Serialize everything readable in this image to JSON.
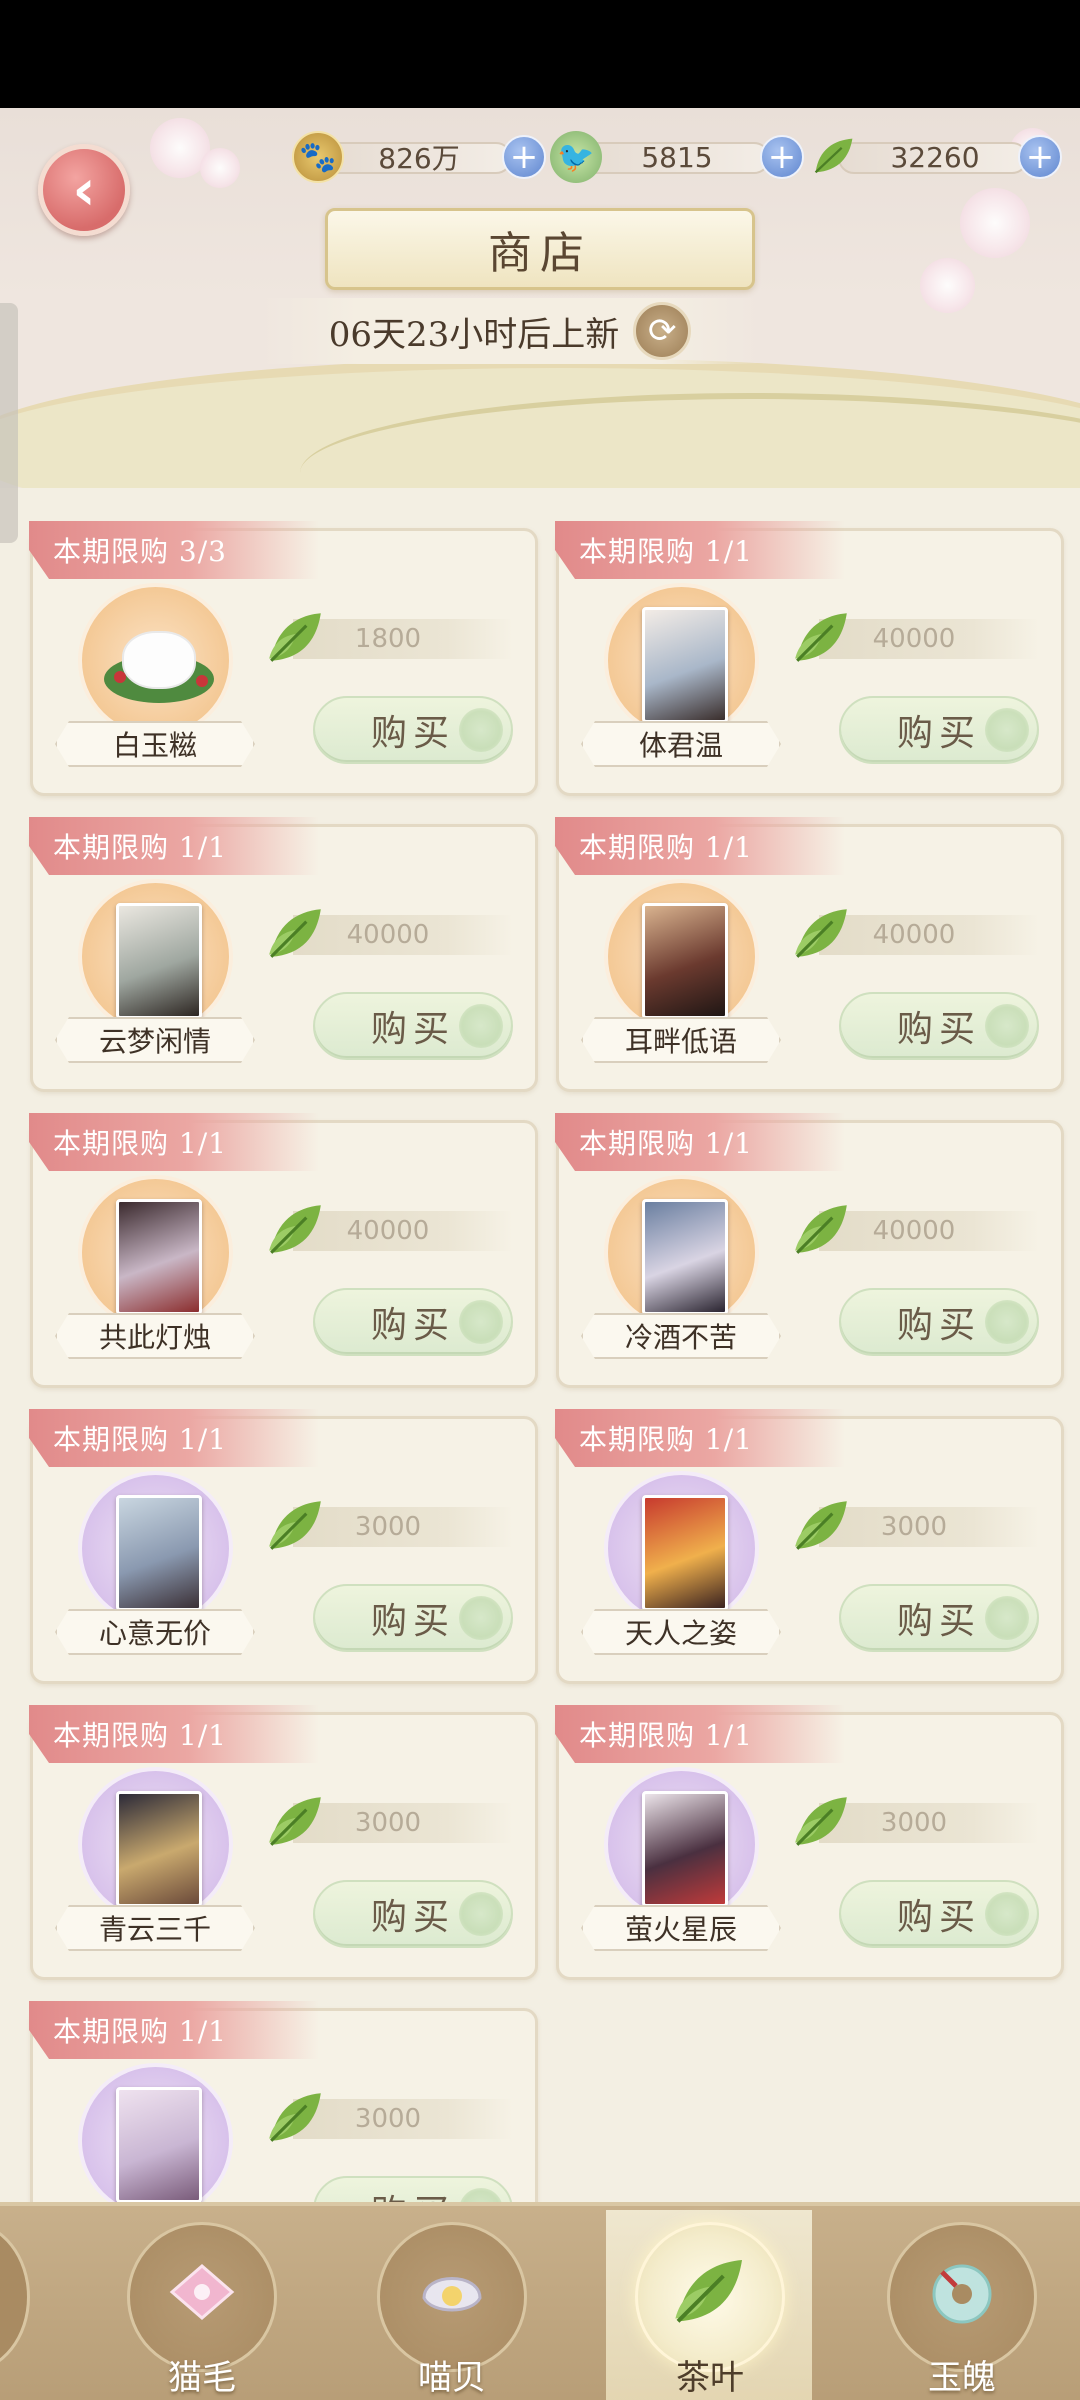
{
  "currencies": [
    {
      "icon": "paw-coin-icon",
      "value": "826万"
    },
    {
      "icon": "green-bird-icon",
      "value": "5815"
    },
    {
      "icon": "tea-leaf-icon",
      "value": "32260"
    }
  ],
  "header": {
    "title": "商店",
    "refresh_text": "06天23小时后上新"
  },
  "items": [
    {
      "limit": "本期限购 3/3",
      "name": "白玉糍",
      "price": "1800",
      "buy_label": "购买",
      "frame": "orange",
      "kind": "food"
    },
    {
      "limit": "本期限购 1/1",
      "name": "体君温",
      "price": "40000",
      "buy_label": "购买",
      "frame": "orange",
      "kind": "card"
    },
    {
      "limit": "本期限购 1/1",
      "name": "云梦闲情",
      "price": "40000",
      "buy_label": "购买",
      "frame": "orange",
      "kind": "card"
    },
    {
      "limit": "本期限购 1/1",
      "name": "耳畔低语",
      "price": "40000",
      "buy_label": "购买",
      "frame": "orange",
      "kind": "card"
    },
    {
      "limit": "本期限购 1/1",
      "name": "共此灯烛",
      "price": "40000",
      "buy_label": "购买",
      "frame": "orange",
      "kind": "card"
    },
    {
      "limit": "本期限购 1/1",
      "name": "冷酒不苦",
      "price": "40000",
      "buy_label": "购买",
      "frame": "orange",
      "kind": "card"
    },
    {
      "limit": "本期限购 1/1",
      "name": "心意无价",
      "price": "3000",
      "buy_label": "购买",
      "frame": "purple",
      "kind": "card"
    },
    {
      "limit": "本期限购 1/1",
      "name": "天人之姿",
      "price": "3000",
      "buy_label": "购买",
      "frame": "purple",
      "kind": "card"
    },
    {
      "limit": "本期限购 1/1",
      "name": "青云三千",
      "price": "3000",
      "buy_label": "购买",
      "frame": "purple",
      "kind": "card"
    },
    {
      "limit": "本期限购 1/1",
      "name": "萤火星辰",
      "price": "3000",
      "buy_label": "购买",
      "frame": "purple",
      "kind": "card"
    },
    {
      "limit": "本期限购 1/1",
      "name": "",
      "price": "3000",
      "buy_label": "购买",
      "frame": "purple",
      "kind": "card"
    }
  ],
  "nav": [
    {
      "label": "猫毛",
      "icon": "pink-cloth-icon",
      "active": false
    },
    {
      "label": "喵贝",
      "icon": "shell-pearl-icon",
      "active": false
    },
    {
      "label": "茶叶",
      "icon": "tea-leaf-icon",
      "active": true
    },
    {
      "label": "玉魄",
      "icon": "jade-disc-icon",
      "active": false
    }
  ],
  "colors": {
    "limit_banner": "#e18a8a",
    "buy_button": "#dcead0",
    "nav_bar": "#b89e77",
    "frame_orange": "#f4c996",
    "frame_purple": "#d8c2eb"
  }
}
